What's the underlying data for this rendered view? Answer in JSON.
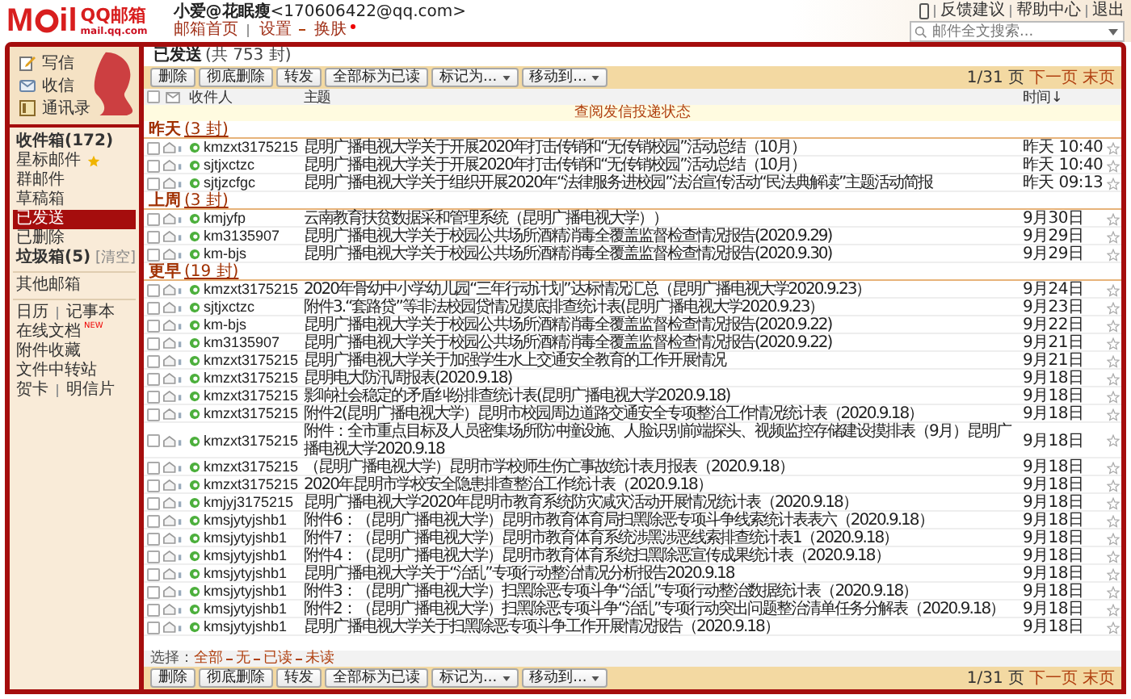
{
  "header": {
    "logo": {
      "left": "M",
      "right": "il",
      "brand": "QQ邮箱",
      "domain": "mail.qq.com"
    },
    "user": {
      "name": "小爱@花眠瘦",
      "email": "<170606422@qq.com>"
    },
    "user_links": [
      {
        "label": "邮箱首页",
        "kind": "link"
      },
      {
        "label": "设置",
        "kind": "link"
      },
      {
        "label": "换肤",
        "kind": "dot"
      }
    ],
    "top_links": [
      "反馈建议",
      "帮助中心",
      "退出"
    ],
    "search": {
      "placeholder": "邮件全文搜索..."
    }
  },
  "sidebar": {
    "actions": [
      {
        "label": "写信",
        "kind": "write"
      },
      {
        "label": "收信",
        "kind": "inbox"
      },
      {
        "label": "通讯录",
        "kind": "contacts"
      }
    ],
    "folders": [
      {
        "label": "收件箱(172)",
        "bold": true,
        "selected": false,
        "kind": "plain"
      },
      {
        "label": "星标邮件",
        "bold": false,
        "selected": false,
        "kind": "star"
      },
      {
        "label": "群邮件",
        "bold": false,
        "selected": false,
        "kind": "plain"
      },
      {
        "label": "草稿箱",
        "bold": false,
        "selected": false,
        "kind": "plain"
      },
      {
        "label": "已发送",
        "bold": false,
        "selected": true,
        "kind": "plain"
      },
      {
        "label": "已删除",
        "bold": false,
        "selected": false,
        "kind": "plain"
      },
      {
        "label": "垃圾箱(5)",
        "bold": true,
        "selected": false,
        "kind": "clear",
        "extra": "[清空]"
      }
    ],
    "other": "其他邮箱",
    "tools": [
      [
        "日历",
        "记事本"
      ],
      [
        "在线文档"
      ],
      [
        "附件收藏"
      ],
      [
        "文件中转站"
      ],
      [
        "贺卡",
        "明信片"
      ]
    ],
    "new_badge": "NEW"
  },
  "mail": {
    "title": "已发送",
    "count": "(共 753 封)",
    "toolbar_top": {
      "buttons": [
        {
          "label": "删除",
          "kind": "plain"
        },
        {
          "label": "彻底删除",
          "kind": "plain"
        },
        {
          "label": "转发",
          "kind": "plain"
        },
        {
          "label": "全部标为已读",
          "kind": "plain"
        },
        {
          "label": "标记为...",
          "kind": "menu"
        },
        {
          "label": "移动到...",
          "kind": "menu"
        }
      ],
      "page": "1/31 页",
      "next": "下一页",
      "last": "末页"
    },
    "select_all_checked": false,
    "columns": [
      "收件人",
      "主题",
      "时间↓"
    ],
    "notice": "查阅发信投递状态",
    "groups": [
      {
        "label": "昨天",
        "count": "(3 封)",
        "rows": [
          {
            "to": "kmzxt3175215",
            "subject": "昆明广播电视大学关于开展2020年打击传销和“无传销校园”活动总结（10月）",
            "time": "昨天 10:40",
            "checked": false,
            "starred": false
          },
          {
            "to": "sjtjxctzc",
            "subject": "昆明广播电视大学关于开展2020年打击传销和“无传销校园”活动总结（10月）",
            "time": "昨天 10:40",
            "checked": false,
            "starred": false
          },
          {
            "to": "sjtjzcfgc",
            "subject": "昆明广播电视大学关于组织开展2020年“法律服务进校园”法治宣传活动“民法典解读”主题活动简报",
            "time": "昨天 09:13",
            "checked": false,
            "starred": false
          }
        ]
      },
      {
        "label": "上周",
        "count": "(3 封)",
        "rows": [
          {
            "to": "kmjyfp",
            "subject": "云南教育扶贫数据采和管理系统（昆明广播电视大学））",
            "time": "9月30日",
            "checked": false,
            "starred": false
          },
          {
            "to": "km3135907",
            "subject": "昆明广播电视大学关于校园公共场所酒精消毒全覆盖监督检查情况报告(2020.9.29)",
            "time": "9月29日",
            "checked": false,
            "starred": false
          },
          {
            "to": "km-bjs",
            "subject": "昆明广播电视大学关于校园公共场所酒精消毒全覆盖监督检查情况报告(2020.9.30)",
            "time": "9月29日",
            "checked": false,
            "starred": false
          }
        ]
      },
      {
        "label": "更早",
        "count": "(19 封)",
        "rows": [
          {
            "to": "kmzxt3175215",
            "subject": "2020年骨幼中小学幼儿园“三年行动计划”达标情况汇总（昆明广播电视大学2020.9.23）",
            "time": "9月24日",
            "checked": false,
            "starred": false
          },
          {
            "to": "sjtjxctzc",
            "subject": "附件3.“套路贷”等非法校园贷情况摸底排查统计表(昆明广播电视大学2020.9.23）",
            "time": "9月23日",
            "checked": false,
            "starred": false
          },
          {
            "to": "km-bjs",
            "subject": "昆明广播电视大学关于校园公共场所酒精消毒全覆盖监督检查情况报告(2020.9.22)",
            "time": "9月22日",
            "checked": false,
            "starred": false
          },
          {
            "to": "km3135907",
            "subject": "昆明广播电视大学关于校园公共场所酒精消毒全覆盖监督检查情况报告(2020.9.22)",
            "time": "9月21日",
            "checked": false,
            "starred": false
          },
          {
            "to": "kmzxt3175215",
            "subject": "昆明广播电视大学关于加强学生水上交通安全教育的工作开展情况",
            "time": "9月21日",
            "checked": false,
            "starred": false
          },
          {
            "to": "kmzxt3175215",
            "subject": "昆明电大防汛周报表(2020.9.18)",
            "time": "9月18日",
            "checked": false,
            "starred": false
          },
          {
            "to": "kmzxt3175215",
            "subject": "影响社会稳定的矛盾纠纷排查统计表(昆明广播电视大学2020.9.18)",
            "time": "9月18日",
            "checked": false,
            "starred": false
          },
          {
            "to": "kmzxt3175215",
            "subject": "附件2(昆明广播电视大学）昆明市校园周边道路交通安全专项整治工作情况统计表（2020.9.18）",
            "time": "9月18日",
            "checked": false,
            "starred": false
          },
          {
            "to": "kmzxt3175215",
            "subject": "附件：全市重点目标及人员密集场所防冲撞设施、人脸识别前端探头、视频监控存储建设摸排表（9月）昆明广播电视大学2020.9.18",
            "time": "9月18日",
            "checked": false,
            "starred": false
          },
          {
            "to": "kmzxt3175215",
            "subject": "（昆明广播电视大学）昆明市学校师生伤亡事故统计表月报表（2020.9.18）",
            "time": "9月18日",
            "checked": false,
            "starred": false
          },
          {
            "to": "kmzxt3175215",
            "subject": "2020年昆明市学校安全隐患排查整治工作统计表（2020.9.18）",
            "time": "9月18日",
            "checked": false,
            "starred": false
          },
          {
            "to": "kmjyj3175215",
            "subject": "昆明广播电视大学2020年昆明市教育系统防灾减灾活动开展情况统计表（2020.9.18）",
            "time": "9月18日",
            "checked": false,
            "starred": false
          },
          {
            "to": "kmsjytyjshb1",
            "subject": "附件6：（昆明广播电视大学）昆明市教育体育局扫黑除恶专项斗争线索统计表表六（2020.9.18）",
            "time": "9月18日",
            "checked": false,
            "starred": false
          },
          {
            "to": "kmsjytyjshb1",
            "subject": "附件7：（昆明广播电视大学）昆明市教育体育系统涉黑涉恶线索排查统计表1（2020.9.18）",
            "time": "9月18日",
            "checked": false,
            "starred": false
          },
          {
            "to": "kmsjytyjshb1",
            "subject": "附件4：（昆明广播电视大学）昆明市教育体育系统扫黑除恶宣传成果统计表（2020.9.18）",
            "time": "9月18日",
            "checked": false,
            "starred": false
          },
          {
            "to": "kmsjytyjshb1",
            "subject": "昆明广播电视大学关于“治乱”专项行动整治情况分析报告2020.9.18",
            "time": "9月18日",
            "checked": false,
            "starred": false
          },
          {
            "to": "kmsjytyjshb1",
            "subject": "附件3：（昆明广播电视大学）扫黑除恶专项斗争“治乱”专项行动整治数据统计表（2020.9.18）",
            "time": "9月18日",
            "checked": false,
            "starred": false
          },
          {
            "to": "kmsjytyjshb1",
            "subject": "附件2：（昆明广播电视大学）扫黑除恶专项斗争“治乱”专项行动突出问题整治清单任务分解表（2020.9.18）",
            "time": "9月18日",
            "checked": false,
            "starred": false
          },
          {
            "to": "kmsjytyjshb1",
            "subject": "昆明广播电视大学关于扫黑除恶专项斗争工作开展情况报告（2020.9.18）",
            "time": "9月18日",
            "checked": false,
            "starred": false
          }
        ]
      }
    ],
    "select": {
      "label": "选择：",
      "options": [
        "全部",
        "无",
        "已读",
        "未读"
      ]
    },
    "toolbar_bottom": {
      "buttons": [
        {
          "label": "删除",
          "kind": "plain"
        },
        {
          "label": "彻底删除",
          "kind": "plain"
        },
        {
          "label": "转发",
          "kind": "plain"
        },
        {
          "label": "全部标为已读",
          "kind": "plain"
        },
        {
          "label": "标记为...",
          "kind": "menu"
        },
        {
          "label": "移动到...",
          "kind": "menu"
        }
      ],
      "page": "1/31 页",
      "next": "下一页",
      "last": "末页"
    }
  }
}
